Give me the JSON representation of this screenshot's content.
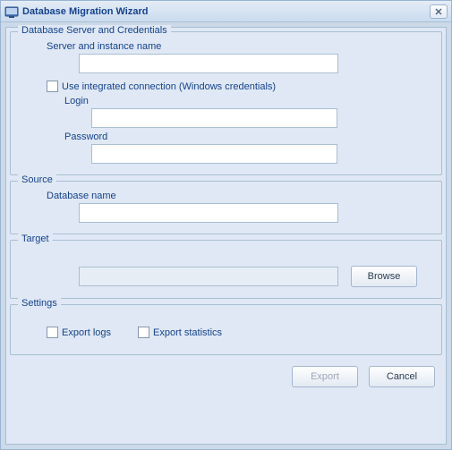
{
  "window": {
    "title": "Database Migration Wizard"
  },
  "credentials": {
    "legend": "Database Server and Credentials",
    "server_label": "Server and instance name",
    "server_value": "",
    "integrated_label": "Use integrated connection (Windows credentials)",
    "integrated_checked": false,
    "login_label": "Login",
    "login_value": "",
    "password_label": "Password",
    "password_value": ""
  },
  "source": {
    "legend": "Source",
    "db_label": "Database name",
    "db_value": ""
  },
  "target": {
    "legend": "Target",
    "path_value": "",
    "browse_label": "Browse"
  },
  "settings": {
    "legend": "Settings",
    "export_logs_label": "Export logs",
    "export_logs_checked": false,
    "export_stats_label": "Export statistics",
    "export_stats_checked": false
  },
  "buttons": {
    "export_label": "Export",
    "export_enabled": false,
    "cancel_label": "Cancel"
  }
}
